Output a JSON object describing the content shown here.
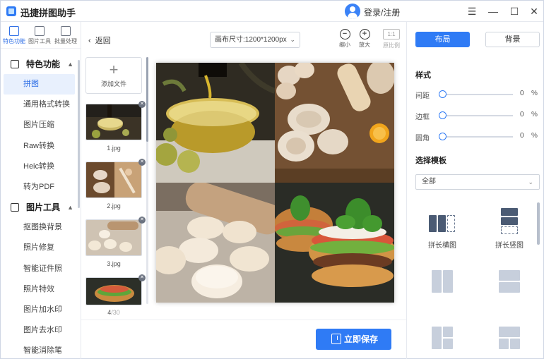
{
  "app": {
    "title": "迅捷拼图助手",
    "login": "登录/注册"
  },
  "window_controls": {
    "menu": "☰",
    "minimize": "—",
    "maximize": "☐",
    "close": "✕"
  },
  "rail": [
    {
      "label": "特色功能",
      "icon": "star-grid-icon",
      "active": true
    },
    {
      "label": "图片工具",
      "icon": "image-tool-icon",
      "active": false
    },
    {
      "label": "批量处理",
      "icon": "batch-icon",
      "active": false
    }
  ],
  "menu": {
    "section1": {
      "label": "特色功能",
      "items": [
        "拼图",
        "通用格式转换",
        "图片压缩",
        "Raw转换",
        "Heic转换",
        "转为PDF"
      ]
    },
    "section2": {
      "label": "图片工具",
      "items": [
        "抠图换背景",
        "照片修复",
        "智能证件照",
        "照片特效",
        "图片加水印",
        "图片去水印",
        "智能消除笔"
      ]
    }
  },
  "toolbar": {
    "back": "返回",
    "canvas_size": "画布尺寸:1200*1200px",
    "zoom_out": "缩小",
    "zoom_in": "放大",
    "ratio_value": "1:1",
    "ratio_label": "原比例"
  },
  "files": {
    "add_label": "添加文件",
    "thumbs": [
      "1.jpg",
      "2.jpg",
      "3.jpg"
    ],
    "current": "4",
    "total": "/30"
  },
  "save_label": "立即保存",
  "panel": {
    "tab_layout": "布局",
    "tab_background": "背景",
    "style_title": "样式",
    "sliders": [
      {
        "label": "间距",
        "value": "0",
        "unit": "%"
      },
      {
        "label": "边框",
        "value": "0",
        "unit": "%"
      },
      {
        "label": "圆角",
        "value": "0",
        "unit": "%"
      }
    ],
    "template_title": "选择模板",
    "template_filter": "全部",
    "templates": [
      "拼长横图",
      "拼长竖图"
    ]
  },
  "colors": {
    "accent": "#2f7bf5",
    "selected_bg": "#e8f0fd"
  }
}
